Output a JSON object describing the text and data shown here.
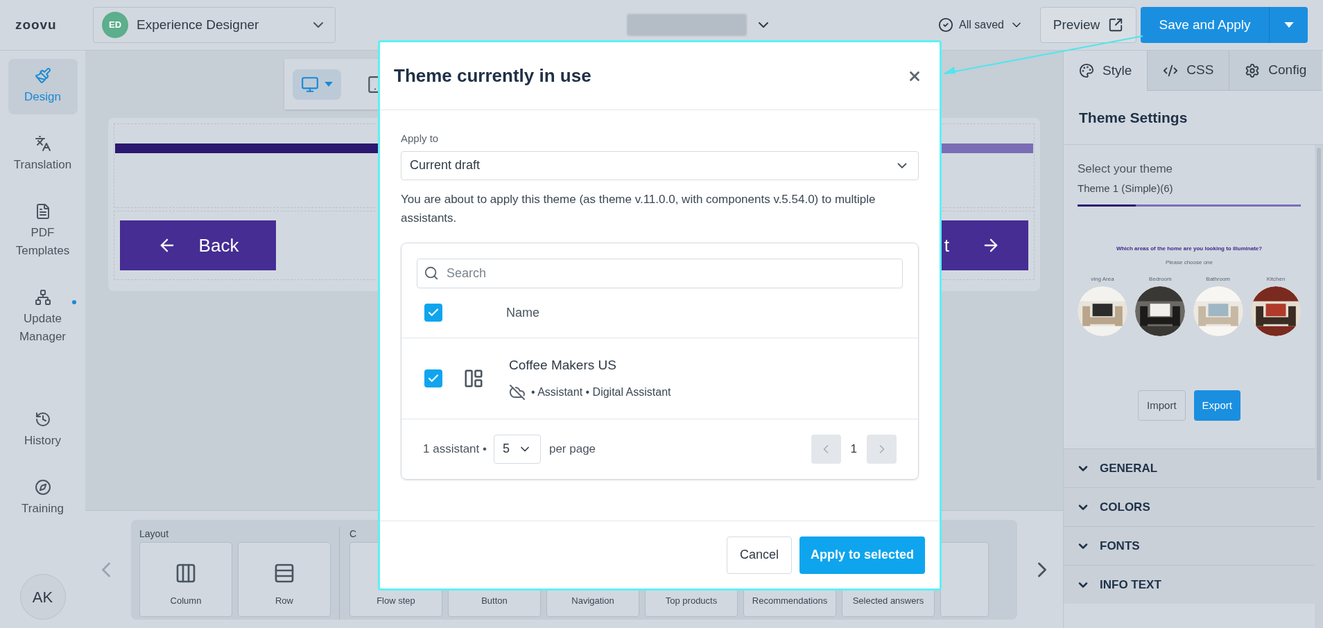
{
  "app_bar": {
    "logo": "zoovu",
    "product_badge": "ED",
    "product": "Experience Designer",
    "save_status": "All saved",
    "preview": "Preview",
    "save_button": "Save and Apply"
  },
  "sidebar": {
    "items": [
      {
        "label": "Design",
        "selected": true,
        "notify": false
      },
      {
        "label": "Translation",
        "selected": false,
        "notify": false
      },
      {
        "label": "PDF Templates",
        "selected": false,
        "notify": false
      },
      {
        "label": "Update Manager",
        "selected": false,
        "notify": true
      },
      {
        "label": "History",
        "selected": false,
        "notify": false
      },
      {
        "label": "Training",
        "selected": false,
        "notify": false
      }
    ],
    "avatar": "AK"
  },
  "canvas": {
    "devices": [
      {
        "selected": true
      },
      {
        "selected": false
      }
    ],
    "progress": {
      "level": 0.5
    },
    "back_button": "Back",
    "next_button": "t"
  },
  "components": {
    "groups": [
      {
        "title": "Layout",
        "tiles": [
          "Column",
          "Row"
        ]
      },
      {
        "title": "C",
        "tiles": [
          "Flow step",
          "Button",
          "Navigation",
          "Top products",
          "Recommendations",
          "Selected answers"
        ]
      }
    ]
  },
  "right_panel": {
    "tabs": [
      {
        "label": "Style",
        "selected": true
      },
      {
        "label": "CSS",
        "selected": false
      },
      {
        "label": "Config",
        "selected": false
      }
    ],
    "heading": "Theme Settings",
    "theme_label": "Select your theme",
    "theme_name": "Theme 1 (Simple)(6)",
    "preview": {
      "level": 0.26,
      "question": "Which areas of the home are you looking to illuminate?",
      "hint": "Please choose one",
      "options": [
        "ving Area",
        "Bedroom",
        "Bathroom",
        "Kitchen"
      ]
    },
    "import": "Import",
    "export": "Export",
    "sections": [
      {
        "label": "GENERAL",
        "expanded": false
      },
      {
        "label": "COLORS",
        "expanded": false
      },
      {
        "label": "FONTS",
        "expanded": false
      },
      {
        "label": "INFO TEXT",
        "expanded": false
      }
    ]
  },
  "dialog": {
    "title": "Theme currently in use",
    "apply_label": "Apply to",
    "apply_value": "Current draft",
    "message": "You are about to apply this theme (as theme v.11.0.0, with components v.5.54.0) to multiple assistants.",
    "search_placeholder": "Search",
    "column": "Name",
    "header_checked": true,
    "rows": [
      {
        "name": "Coffee Makers US",
        "meta": "• Assistant • Digital Assistant",
        "checked": true
      }
    ],
    "count": "1 assistant •",
    "page_size": "5",
    "per_page": "per page",
    "page": "1",
    "prev_disabled": true,
    "next_disabled": true,
    "cancel": "Cancel",
    "apply": "Apply to selected"
  }
}
